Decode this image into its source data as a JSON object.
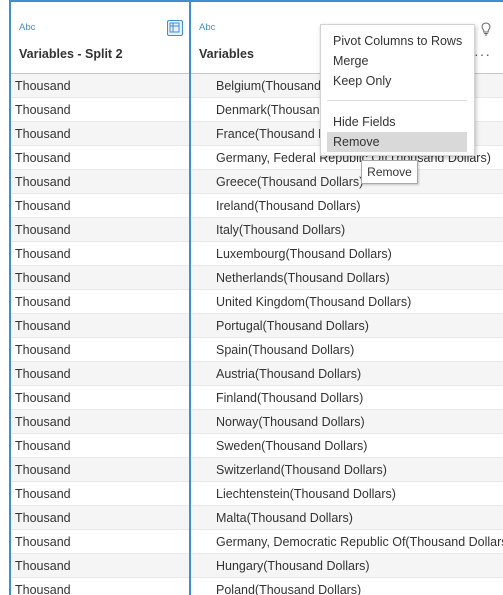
{
  "columns": [
    {
      "type_tag": "Abc",
      "title": "Variables - Split 2"
    },
    {
      "type_tag": "Abc",
      "title": "Variables"
    }
  ],
  "rows": [
    {
      "split2": "Thousand",
      "variables": "Belgium(Thousand Dollars)"
    },
    {
      "split2": "Thousand",
      "variables": "Denmark(Thousand Dollars)"
    },
    {
      "split2": "Thousand",
      "variables": "France(Thousand Dollars)"
    },
    {
      "split2": "Thousand",
      "variables": "Germany, Federal Republic Of(Thousand Dollars)"
    },
    {
      "split2": "Thousand",
      "variables": "Greece(Thousand Dollars)"
    },
    {
      "split2": "Thousand",
      "variables": "Ireland(Thousand Dollars)"
    },
    {
      "split2": "Thousand",
      "variables": "Italy(Thousand Dollars)"
    },
    {
      "split2": "Thousand",
      "variables": "Luxembourg(Thousand Dollars)"
    },
    {
      "split2": "Thousand",
      "variables": "Netherlands(Thousand Dollars)"
    },
    {
      "split2": "Thousand",
      "variables": "United Kingdom(Thousand Dollars)"
    },
    {
      "split2": "Thousand",
      "variables": "Portugal(Thousand Dollars)"
    },
    {
      "split2": "Thousand",
      "variables": "Spain(Thousand Dollars)"
    },
    {
      "split2": "Thousand",
      "variables": "Austria(Thousand Dollars)"
    },
    {
      "split2": "Thousand",
      "variables": "Finland(Thousand Dollars)"
    },
    {
      "split2": "Thousand",
      "variables": "Norway(Thousand Dollars)"
    },
    {
      "split2": "Thousand",
      "variables": "Sweden(Thousand Dollars)"
    },
    {
      "split2": "Thousand",
      "variables": "Switzerland(Thousand Dollars)"
    },
    {
      "split2": "Thousand",
      "variables": "Liechtenstein(Thousand Dollars)"
    },
    {
      "split2": "Thousand",
      "variables": "Malta(Thousand Dollars)"
    },
    {
      "split2": "Thousand",
      "variables": "Germany, Democratic Republic Of(Thousand Dollars)"
    },
    {
      "split2": "Thousand",
      "variables": "Hungary(Thousand Dollars)"
    },
    {
      "split2": "Thousand",
      "variables": "Poland(Thousand Dollars)"
    }
  ],
  "context_menu": {
    "items": [
      "Pivot Columns to Rows",
      "Merge",
      "Keep Only",
      "Hide Fields",
      "Remove"
    ],
    "highlighted": "Remove"
  },
  "tooltip": "Remove",
  "icons": {
    "column1_header": "pivot-table-icon",
    "column2_header": "lightbulb-icon",
    "column2_more": "more-options-icon"
  },
  "colors": {
    "selection_border": "#3f8fd0",
    "type_tag": "#3f8fd0",
    "menu_highlight": "#d9d9d9"
  }
}
